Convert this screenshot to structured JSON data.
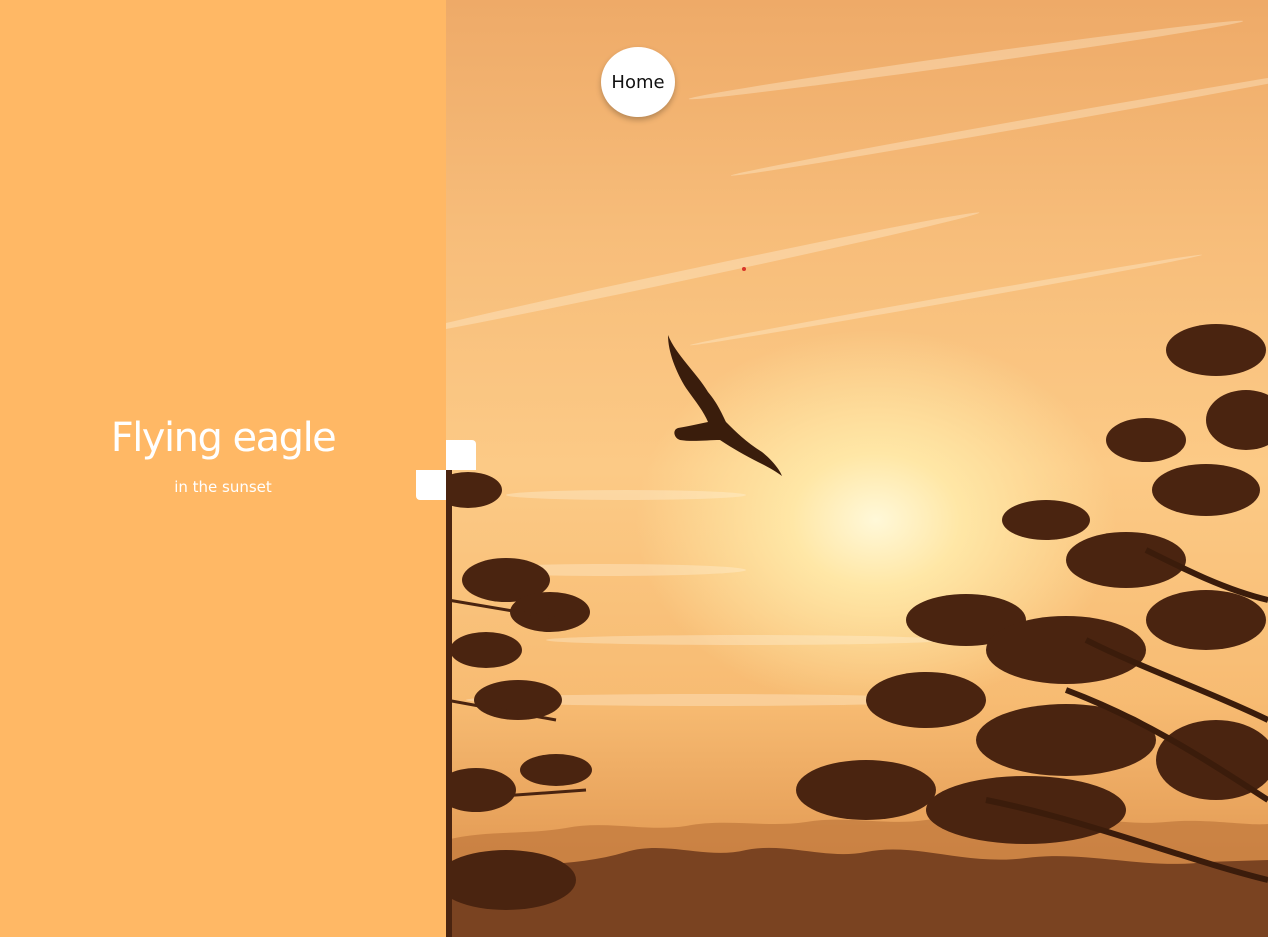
{
  "hero": {
    "title": "Flying eagle",
    "subtitle": "in the sunset"
  },
  "nav": {
    "home_label": "Home"
  },
  "image": {
    "subject": "eagle-silhouette-sunset"
  },
  "colors": {
    "panel": "#ffb865",
    "accent_white": "#ffffff"
  }
}
